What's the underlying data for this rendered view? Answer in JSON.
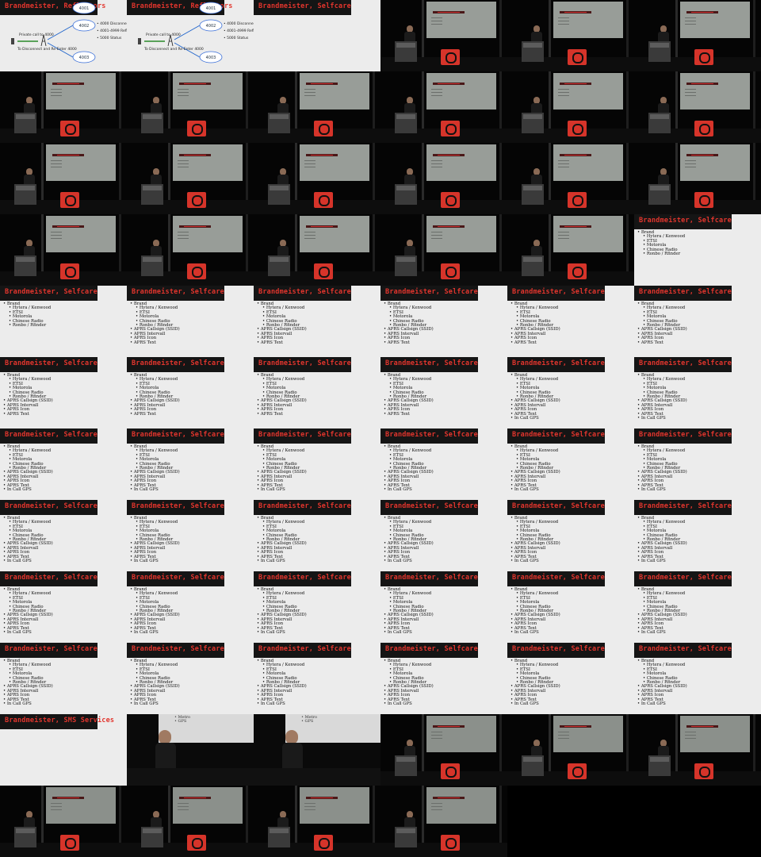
{
  "titles": {
    "reflectors": "Brandmeister, Reflectors",
    "selfcare": "Brandmeister, Selfcare",
    "sms": "Brandmeister, SMS Services"
  },
  "diagram": {
    "callout": "Private call to 4000",
    "callout2": "To Disconnect and Re-Enter 4000",
    "nodes": [
      "4001",
      "4002",
      "4003"
    ],
    "options": [
      "4000 Disconnect",
      "4001-4999 Reflector",
      "5000 Status"
    ]
  },
  "selfcare_items": [
    {
      "text": "Brand",
      "level": 0
    },
    {
      "text": "Hytera / Kenwood",
      "level": 1
    },
    {
      "text": "ETSI",
      "level": 1
    },
    {
      "text": "Motorola",
      "level": 1
    },
    {
      "text": "Chinese Radio",
      "level": 1
    },
    {
      "text": "Ronbo / Rfinder",
      "level": 1
    },
    {
      "text": "APRS Callsign (SSID)",
      "level": 0
    },
    {
      "text": "APRS Intervall",
      "level": 0
    },
    {
      "text": "APRS Icon",
      "level": 0
    },
    {
      "text": "APRS Text",
      "level": 0
    },
    {
      "text": "In Call GPS",
      "level": 0
    }
  ],
  "closeup_text": [
    "• Metro",
    "• GPS"
  ],
  "cells": [
    {
      "kind": "diagram",
      "title": "reflectors"
    },
    {
      "kind": "diagram",
      "title": "reflectors"
    },
    {
      "kind": "slide",
      "title": "selfcare",
      "items": 0
    },
    {
      "kind": "stage"
    },
    {
      "kind": "stage"
    },
    {
      "kind": "stage"
    },
    {
      "kind": "stage"
    },
    {
      "kind": "stage"
    },
    {
      "kind": "stage"
    },
    {
      "kind": "stage"
    },
    {
      "kind": "stage"
    },
    {
      "kind": "stage"
    },
    {
      "kind": "stage"
    },
    {
      "kind": "stage"
    },
    {
      "kind": "stage"
    },
    {
      "kind": "stage"
    },
    {
      "kind": "stage"
    },
    {
      "kind": "stage"
    },
    {
      "kind": "stage"
    },
    {
      "kind": "stage"
    },
    {
      "kind": "stage"
    },
    {
      "kind": "stage"
    },
    {
      "kind": "stage"
    },
    {
      "kind": "slide",
      "title": "selfcare",
      "items": 6
    },
    {
      "kind": "slide",
      "title": "selfcare",
      "items": 6
    },
    {
      "kind": "slide",
      "title": "selfcare",
      "items": 10
    },
    {
      "kind": "slide",
      "title": "selfcare",
      "items": 10
    },
    {
      "kind": "slide",
      "title": "selfcare",
      "items": 10
    },
    {
      "kind": "slide",
      "title": "selfcare",
      "items": 10
    },
    {
      "kind": "slide",
      "title": "selfcare",
      "items": 10
    },
    {
      "kind": "slide",
      "title": "selfcare",
      "items": 10
    },
    {
      "kind": "slide",
      "title": "selfcare",
      "items": 10
    },
    {
      "kind": "slide",
      "title": "selfcare",
      "items": 10
    },
    {
      "kind": "slide",
      "title": "selfcare",
      "items": 10
    },
    {
      "kind": "slide",
      "title": "selfcare",
      "items": 11
    },
    {
      "kind": "slide",
      "title": "selfcare",
      "items": 11
    },
    {
      "kind": "slide",
      "title": "selfcare",
      "items": 11
    },
    {
      "kind": "slide",
      "title": "selfcare",
      "items": 11
    },
    {
      "kind": "slide",
      "title": "selfcare",
      "items": 11
    },
    {
      "kind": "slide",
      "title": "selfcare",
      "items": 11
    },
    {
      "kind": "slide",
      "title": "selfcare",
      "items": 11
    },
    {
      "kind": "slide",
      "title": "selfcare",
      "items": 11
    },
    {
      "kind": "slide",
      "title": "selfcare",
      "items": 11
    },
    {
      "kind": "slide",
      "title": "selfcare",
      "items": 11
    },
    {
      "kind": "slide",
      "title": "selfcare",
      "items": 11
    },
    {
      "kind": "slide",
      "title": "selfcare",
      "items": 11
    },
    {
      "kind": "slide",
      "title": "selfcare",
      "items": 11
    },
    {
      "kind": "slide",
      "title": "selfcare",
      "items": 11
    },
    {
      "kind": "slide",
      "title": "selfcare",
      "items": 11
    },
    {
      "kind": "slide",
      "title": "selfcare",
      "items": 11
    },
    {
      "kind": "slide",
      "title": "selfcare",
      "items": 11
    },
    {
      "kind": "slide",
      "title": "selfcare",
      "items": 11
    },
    {
      "kind": "slide",
      "title": "selfcare",
      "items": 11
    },
    {
      "kind": "slide",
      "title": "selfcare",
      "items": 11
    },
    {
      "kind": "slide",
      "title": "selfcare",
      "items": 11
    },
    {
      "kind": "slide",
      "title": "selfcare",
      "items": 11
    },
    {
      "kind": "slide",
      "title": "selfcare",
      "items": 11
    },
    {
      "kind": "slide",
      "title": "selfcare",
      "items": 11
    },
    {
      "kind": "slide",
      "title": "selfcare",
      "items": 11
    },
    {
      "kind": "slide",
      "title": "selfcare",
      "items": 11
    },
    {
      "kind": "slide",
      "title": "sms",
      "items": 0
    },
    {
      "kind": "close"
    },
    {
      "kind": "close"
    },
    {
      "kind": "stage",
      "variant": "sd"
    },
    {
      "kind": "stage",
      "variant": "sd"
    },
    {
      "kind": "stage",
      "variant": "sd"
    },
    {
      "kind": "stage",
      "variant": "sd"
    },
    {
      "kind": "stage",
      "variant": "sd"
    },
    {
      "kind": "stage",
      "variant": "sd"
    },
    {
      "kind": "stage",
      "variant": "sd"
    }
  ]
}
